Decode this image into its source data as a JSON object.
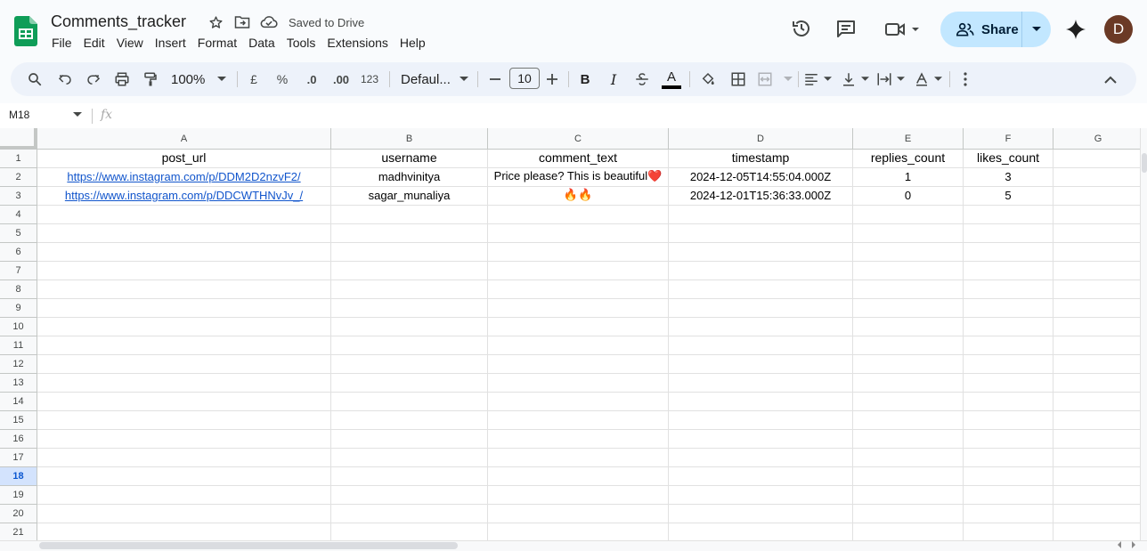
{
  "doc": {
    "title": "Comments_tracker",
    "saved_status": "Saved to Drive"
  },
  "menu": [
    "File",
    "Edit",
    "View",
    "Insert",
    "Format",
    "Data",
    "Tools",
    "Extensions",
    "Help"
  ],
  "share": {
    "label": "Share"
  },
  "user": {
    "initial": "D",
    "avatar_color": "#6b3a26"
  },
  "toolbar": {
    "zoom": "100%",
    "currency": "£",
    "percent": "%",
    "dec_decrease": ".0",
    "dec_increase": ".00",
    "number_format": "123",
    "font": "Defaul...",
    "font_size": "10",
    "bold": "B",
    "italic": "I",
    "text_color_letter": "A"
  },
  "formula_bar": {
    "name_box": "M18",
    "fx": "fx"
  },
  "sheet": {
    "columns": [
      {
        "letter": "A"
      },
      {
        "letter": "B"
      },
      {
        "letter": "C"
      },
      {
        "letter": "D"
      },
      {
        "letter": "E"
      },
      {
        "letter": "F"
      },
      {
        "letter": "G"
      }
    ],
    "row_numbers": [
      "1",
      "2",
      "3",
      "4",
      "5",
      "6",
      "7",
      "8",
      "9",
      "10",
      "11",
      "12",
      "13",
      "14",
      "15",
      "16",
      "17",
      "18",
      "19",
      "20",
      "21"
    ],
    "selected_row": "18",
    "header_row": [
      "post_url",
      "username",
      "comment_text",
      "timestamp",
      "replies_count",
      "likes_count",
      ""
    ],
    "rows": [
      [
        "https://www.instagram.com/p/DDM2D2nzvF2/",
        "madhvinitya",
        "Price please? This is beautiful❤️",
        "2024-12-05T14:55:04.000Z",
        "1",
        "3",
        ""
      ],
      [
        "https://www.instagram.com/p/DDCWTHNvJv_/",
        "sagar_munaliya",
        "🔥🔥",
        "2024-12-01T15:36:33.000Z",
        "0",
        "5",
        ""
      ]
    ]
  },
  "colors": {
    "accent": "#0b57d0",
    "share_bg": "#c2e7ff",
    "link": "#1155cc"
  }
}
